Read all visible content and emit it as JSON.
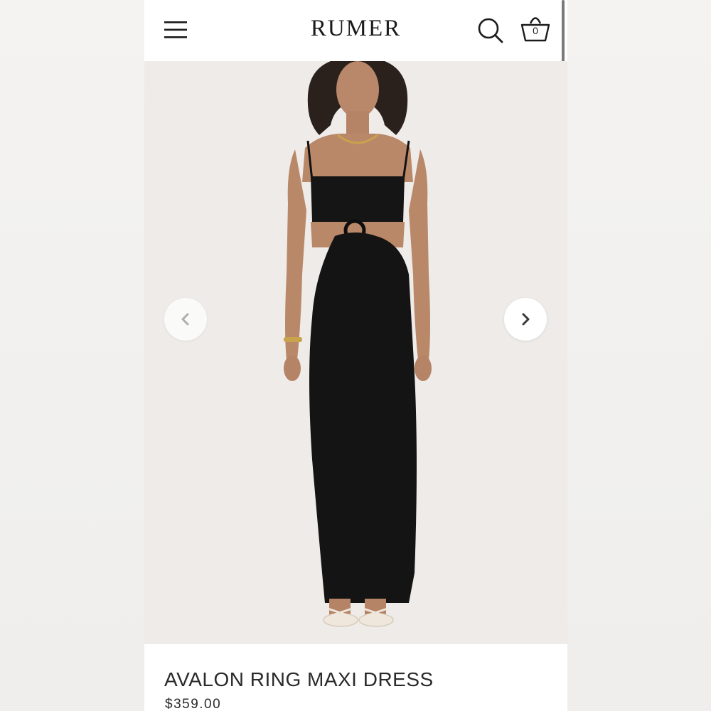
{
  "header": {
    "brand": "RUMER",
    "menu_icon": "hamburger-menu-icon",
    "search_icon": "search-icon",
    "cart_icon": "basket-icon",
    "cart_count": "0"
  },
  "gallery": {
    "prev_icon": "chevron-left-icon",
    "next_icon": "chevron-right-icon",
    "image_subject": "model-wearing-black-maxi-dress"
  },
  "product": {
    "title": "AVALON RING MAXI DRESS",
    "price": "$359.00"
  },
  "colors": {
    "background": "#f2f1ef",
    "page": "#ffffff",
    "text": "#1b1b1b",
    "dress": "#141414",
    "image_bg": "#eeebe8"
  }
}
